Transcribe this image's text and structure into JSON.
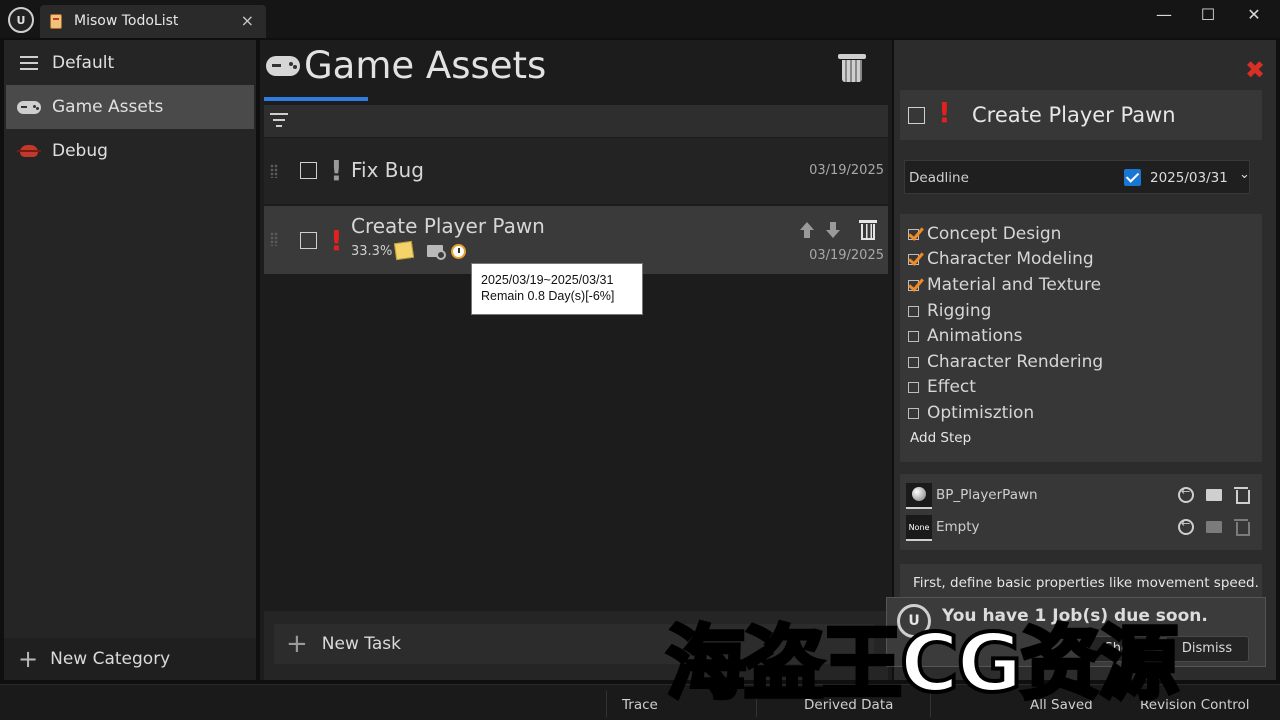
{
  "window": {
    "tab_title": "Misow TodoList",
    "tab_close": "×",
    "minimize": "—",
    "maximize": "☐",
    "close": "✕"
  },
  "categories": {
    "items": [
      {
        "label": "Default",
        "icon": "hamburger-icon"
      },
      {
        "label": "Game Assets",
        "icon": "gamepad-icon",
        "active": true
      },
      {
        "label": "Debug",
        "icon": "bug-icon"
      }
    ],
    "new_category_plus": "+",
    "new_category_label": "New Category"
  },
  "main": {
    "title": "Game Assets",
    "tasks": [
      {
        "title": "Fix Bug",
        "priority_mark": "!",
        "priority_color": "#9a9a9a",
        "date": "03/19/2025"
      },
      {
        "title": "Create Player Pawn",
        "priority_mark": "!",
        "priority_color": "#e32020",
        "progress": "33.3%",
        "date": "03/19/2025"
      }
    ],
    "tooltip": {
      "line1": "2025/03/19~2025/03/31",
      "line2": "Remain 0.8 Day(s)[-6%]"
    },
    "new_task_plus": "+",
    "new_task_label": "New Task"
  },
  "detail": {
    "close_mark": "✖",
    "priority_mark": "!",
    "title": "Create Player Pawn",
    "deadline_label": "Deadline",
    "deadline_date": "2025/03/31",
    "deadline_chevron": "⌄",
    "steps": [
      {
        "label": "Concept Design",
        "done": true
      },
      {
        "label": "Character Modeling",
        "done": true
      },
      {
        "label": "Material and Texture",
        "done": true
      },
      {
        "label": "Rigging",
        "done": false
      },
      {
        "label": "Animations",
        "done": false
      },
      {
        "label": "Character Rendering",
        "done": false
      },
      {
        "label": "Effect",
        "done": false
      },
      {
        "label": "Optimisztion",
        "done": false
      }
    ],
    "add_step": "Add Step",
    "assets": [
      {
        "name": "BP_PlayerPawn"
      },
      {
        "name": "Empty",
        "thumb_text": "None"
      }
    ],
    "description": "First, define basic properties like movement speed."
  },
  "notification": {
    "message": "You have 1 Job(s) due soon.",
    "show_label": "Show",
    "dismiss_label": "Dismiss"
  },
  "statusbar": {
    "trace": "Trace",
    "derived_data": "Derived Data",
    "all_saved": "All Saved",
    "revision_control": "Revision Control"
  },
  "watermark": "海盗王CG资源",
  "colors": {
    "accent": "#2f7be0",
    "high_priority": "#e32020",
    "step_check": "#f08a24",
    "deadline_check": "#1976d2"
  }
}
